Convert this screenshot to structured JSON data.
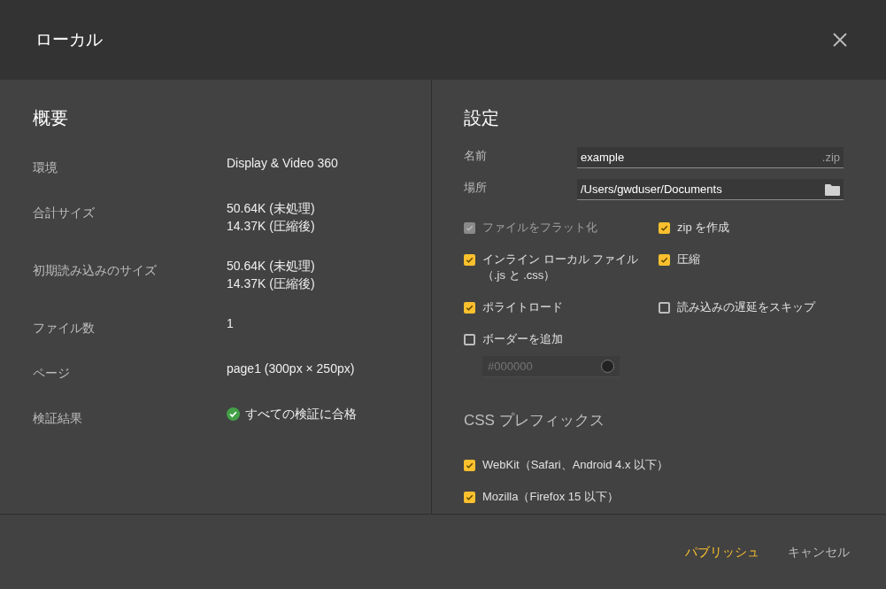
{
  "dialog": {
    "title": "ローカル"
  },
  "summary": {
    "heading": "概要",
    "rows": [
      {
        "label": "環境",
        "lines": [
          "Display & Video 360"
        ]
      },
      {
        "label": "合計サイズ",
        "lines": [
          "50.64K (未処理)",
          "14.37K (圧縮後)"
        ]
      },
      {
        "label": "初期読み込みのサイズ",
        "lines": [
          "50.64K (未処理)",
          "14.37K (圧縮後)"
        ]
      },
      {
        "label": "ファイル数",
        "lines": [
          "1"
        ]
      },
      {
        "label": "ページ",
        "lines": [
          "page1 (300px × 250px)"
        ]
      },
      {
        "label": "検証結果",
        "lines": [
          "すべての検証に合格"
        ],
        "kind": "passed"
      }
    ]
  },
  "settings": {
    "heading": "設定",
    "name_field": {
      "label": "名前",
      "value": "example",
      "suffix": ".zip"
    },
    "location_field": {
      "label": "場所",
      "value": "/Users/gwduser/Documents"
    },
    "options": [
      {
        "label": "ファイルをフラット化",
        "checked": true,
        "disabled": true
      },
      {
        "label": "zip を作成",
        "checked": true,
        "disabled": false
      },
      {
        "label": "インライン ローカル ファイル（.js と .css）",
        "checked": true,
        "disabled": false
      },
      {
        "label": "圧縮",
        "checked": true,
        "disabled": false
      },
      {
        "label": "ポライトロード",
        "checked": true,
        "disabled": false
      },
      {
        "label": "読み込みの遅延をスキップ",
        "checked": false,
        "disabled": false
      },
      {
        "label": "ボーダーを追加",
        "checked": false,
        "disabled": false
      }
    ],
    "border_color_field": {
      "placeholder": "#000000",
      "disabled": true
    },
    "prefix_heading": "CSS プレフィックス",
    "prefixes": [
      {
        "label": "WebKit（Safari、Android 4.x 以下）",
        "checked": true
      },
      {
        "label": "Mozilla（Firefox 15 以下）",
        "checked": true
      }
    ]
  },
  "buttons": [
    {
      "label": "パブリッシュ",
      "kind": "primary"
    },
    {
      "label": "キャンセル",
      "kind": "secondary"
    }
  ]
}
